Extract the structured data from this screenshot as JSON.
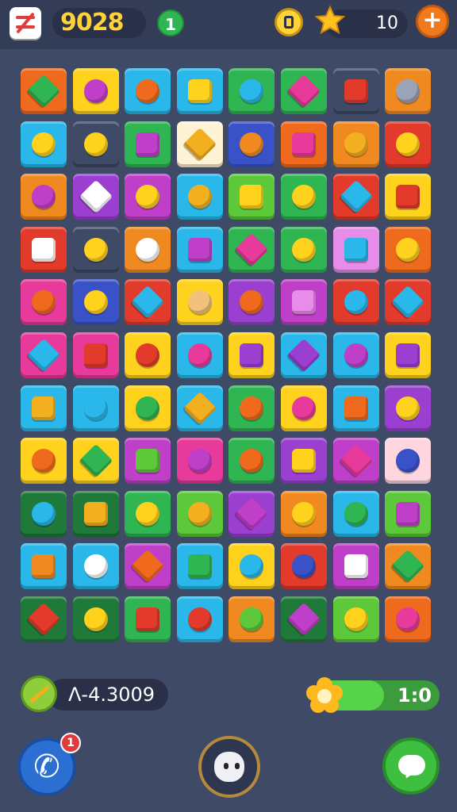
{
  "header": {
    "score": "9028",
    "level": "1",
    "stars": "10",
    "plus_label": "+"
  },
  "footer": {
    "timer": "Ʌ-4.3009",
    "progress_text": "1:0",
    "progress_fraction": 0.55,
    "notification_count": "1"
  },
  "board": {
    "rows": 11,
    "cols": 8,
    "tiles": [
      [
        "#f06a1e",
        "#ffd21e",
        "#2ab8ea",
        "#2ab8ea",
        "#2fb552",
        "#2fb552",
        "#3f4a66",
        "#f08a20"
      ],
      [
        "#2ab8ea",
        "#3f4a66",
        "#2fb552",
        "#fff3d6",
        "#3a52c8",
        "#f06a1e",
        "#f08a20",
        "#e23b2b"
      ],
      [
        "#f08a20",
        "#9a3fd0",
        "#c03fc8",
        "#2ab8ea",
        "#5cc83a",
        "#2fb552",
        "#e23b2b",
        "#ffd21e"
      ],
      [
        "#e23b2b",
        "#3f4a66",
        "#f08a20",
        "#2ab8ea",
        "#2fb552",
        "#2fb552",
        "#e78ce8",
        "#f06a1e"
      ],
      [
        "#e83a9a",
        "#3a52c8",
        "#e23b2b",
        "#ffd21e",
        "#9a3fd0",
        "#c03fc8",
        "#e23b2b",
        "#e23b2b"
      ],
      [
        "#e83a9a",
        "#e83a9a",
        "#ffd21e",
        "#2ab8ea",
        "#ffd21e",
        "#2ab8ea",
        "#2ab8ea",
        "#ffd21e"
      ],
      [
        "#2ab8ea",
        "#2ab8ea",
        "#ffd21e",
        "#2ab8ea",
        "#2fb552",
        "#ffd21e",
        "#2ab8ea",
        "#9a3fd0"
      ],
      [
        "#ffd21e",
        "#ffd21e",
        "#c03fc8",
        "#e83a9a",
        "#2fb552",
        "#9a3fd0",
        "#c03fc8",
        "#ffd6e0"
      ],
      [
        "#1f7a3a",
        "#1f7a3a",
        "#2fb552",
        "#5cc83a",
        "#9a3fd0",
        "#f08a20",
        "#2ab8ea",
        "#5cc83a"
      ],
      [
        "#2ab8ea",
        "#2ab8ea",
        "#c03fc8",
        "#2ab8ea",
        "#ffd21e",
        "#e23b2b",
        "#c03fc8",
        "#f08a20"
      ],
      [
        "#1f7a3a",
        "#1f7a3a",
        "#2fb552",
        "#2ab8ea",
        "#f08a20",
        "#1f7a3a",
        "#5cc83a",
        "#f06a1e"
      ]
    ],
    "gems": [
      [
        "#2fb552",
        "#c03fc8",
        "#f06a1e",
        "#ffd21e",
        "#2ab8ea",
        "#e83a9a",
        "#e23b2b",
        "#9aa3b8"
      ],
      [
        "#ffd21e",
        "#ffd21e",
        "#c03fc8",
        "#f2b021",
        "#f08a20",
        "#e83a9a",
        "#f2b021",
        "#ffd21e"
      ],
      [
        "#c03fc8",
        "#ffffff",
        "#ffd21e",
        "#f2b021",
        "#ffd21e",
        "#ffd21e",
        "#2ab8ea",
        "#e23b2b"
      ],
      [
        "#ffffff",
        "#ffd21e",
        "#ffffff",
        "#c03fc8",
        "#e83a9a",
        "#ffd21e",
        "#2ab8ea",
        "#ffd21e"
      ],
      [
        "#f06a1e",
        "#ffd21e",
        "#2ab8ea",
        "#f2c27a",
        "#f06a1e",
        "#e78ce8",
        "#2ab8ea",
        "#2ab8ea"
      ],
      [
        "#2ab8ea",
        "#e23b2b",
        "#e23b2b",
        "#e83a9a",
        "#9a3fd0",
        "#9a3fd0",
        "#c03fc8",
        "#9a3fd0"
      ],
      [
        "#f2b021",
        "#2ab8ea",
        "#2fb552",
        "#f2b021",
        "#f06a1e",
        "#e83a9a",
        "#f06a1e",
        "#ffd21e"
      ],
      [
        "#f06a1e",
        "#2fb552",
        "#5cc83a",
        "#c03fc8",
        "#f06a1e",
        "#ffd21e",
        "#e83a9a",
        "#3a52c8"
      ],
      [
        "#2ab8ea",
        "#f2b021",
        "#ffd21e",
        "#f2b021",
        "#c03fc8",
        "#ffd21e",
        "#2fb552",
        "#c03fc8"
      ],
      [
        "#f08a20",
        "#ffffff",
        "#f06a1e",
        "#2fb552",
        "#2ab8ea",
        "#3a52c8",
        "#ffffff",
        "#2fb552"
      ],
      [
        "#e23b2b",
        "#ffd21e",
        "#e23b2b",
        "#e23b2b",
        "#5cc83a",
        "#c03fc8",
        "#ffd21e",
        "#e83a9a"
      ]
    ]
  },
  "colors": {
    "background": "#3f4a66",
    "topbar": "#333d57",
    "accent_orange": "#f07a1c",
    "accent_green": "#3fbf3f",
    "score_yellow": "#ffd23a"
  },
  "icons": [
    "app-logo-icon",
    "coin-icon",
    "star-icon",
    "plus-icon",
    "weapon-icon",
    "flower-icon",
    "phone-icon",
    "avatar-icon",
    "chat-icon"
  ]
}
